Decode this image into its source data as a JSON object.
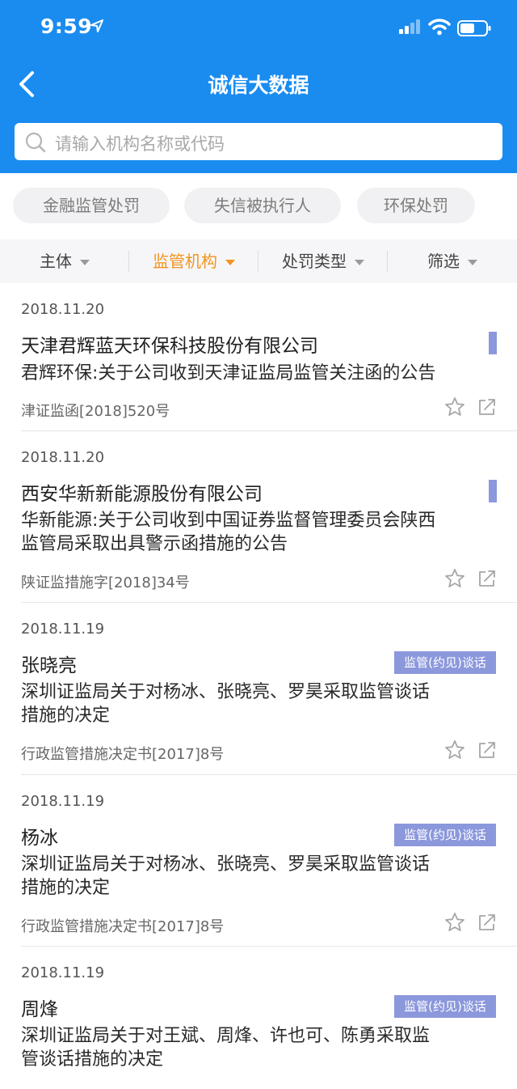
{
  "status": {
    "time": "9:59",
    "location_icon": "location-arrow-icon",
    "signal_icon": "cellular-signal-icon",
    "wifi_icon": "wifi-icon",
    "battery_icon": "battery-icon"
  },
  "header": {
    "title": "诚信大数据",
    "back_icon": "chevron-left-icon"
  },
  "search": {
    "placeholder": "请输入机构名称或代码",
    "icon": "search-icon"
  },
  "categories": [
    "金融监管处罚",
    "失信被执行人",
    "环保处罚"
  ],
  "filters": [
    {
      "label": "主体",
      "active": false
    },
    {
      "label": "监管机构",
      "active": true
    },
    {
      "label": "处罚类型",
      "active": false
    },
    {
      "label": "筛选",
      "active": false
    }
  ],
  "colors": {
    "primary": "#1a8cf0",
    "active_filter": "#f2941e",
    "tag": "#8c98dc"
  },
  "items": [
    {
      "date": "2018.11.20",
      "entity": "天津君辉蓝天环保科技股份有限公司",
      "desc_lines": [
        "君辉环保:关于公司收到天津证监局监管关注函的公告"
      ],
      "ref": "津证监函[2018]520号",
      "tag": ""
    },
    {
      "date": "2018.11.20",
      "entity": "西安华新新能源股份有限公司",
      "desc_lines": [
        "华新能源:关于公司收到中国证券监督管理委员会陕西",
        "监管局采取出具警示函措施的公告"
      ],
      "ref": "陕证监措施字[2018]34号",
      "tag": ""
    },
    {
      "date": "2018.11.19",
      "entity": "张晓亮",
      "desc_lines": [
        "深圳证监局关于对杨冰、张晓亮、罗昊采取监管谈话",
        "措施的决定"
      ],
      "ref": "行政监管措施决定书[2017]8号",
      "tag": "监管(约见)谈话"
    },
    {
      "date": "2018.11.19",
      "entity": "杨冰",
      "desc_lines": [
        "深圳证监局关于对杨冰、张晓亮、罗昊采取监管谈话",
        "措施的决定"
      ],
      "ref": "行政监管措施决定书[2017]8号",
      "tag": "监管(约见)谈话"
    },
    {
      "date": "2018.11.19",
      "entity": "周烽",
      "desc_lines": [
        "深圳证监局关于对王斌、周烽、许也可、陈勇采取监",
        "管谈话措施的决定"
      ],
      "ref": "",
      "tag": "监管(约见)谈话"
    }
  ]
}
